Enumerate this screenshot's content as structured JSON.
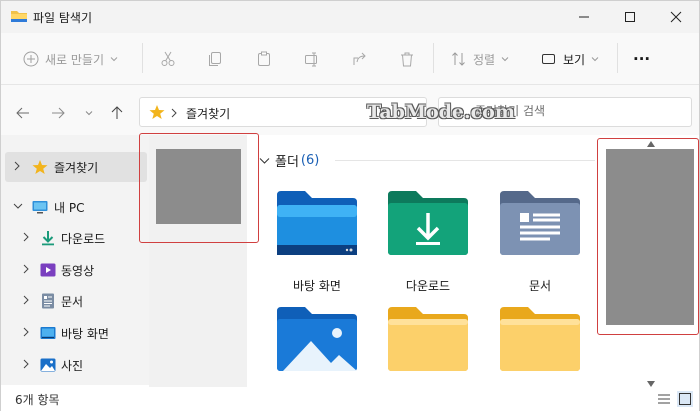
{
  "window": {
    "title": "파일 탐색기"
  },
  "title_controls": {
    "minimize": "—",
    "maximize": "☐",
    "close": "✕"
  },
  "toolbar": {
    "new_label": "새로 만들기",
    "sort_label": "정렬",
    "view_label": "보기",
    "more_label": "···"
  },
  "address": {
    "crumb": "즐겨찾기"
  },
  "search": {
    "placeholder": "즐겨찾기 검색"
  },
  "watermark": "TabMode.com",
  "sidebar": {
    "items": [
      {
        "label": "즐겨찾기",
        "icon": "star-icon"
      },
      {
        "label": "내 PC",
        "icon": "pc-icon"
      },
      {
        "label": "다운로드",
        "icon": "download-icon"
      },
      {
        "label": "동영상",
        "icon": "video-icon"
      },
      {
        "label": "문서",
        "icon": "document-icon"
      },
      {
        "label": "바탕 화면",
        "icon": "desktop-icon"
      },
      {
        "label": "사진",
        "icon": "pictures-icon"
      }
    ]
  },
  "main": {
    "section_title": "폴더",
    "section_count": "(6)",
    "folders": [
      {
        "label": "바탕 화면",
        "icon": "desktop-folder-icon"
      },
      {
        "label": "다운로드",
        "icon": "downloads-folder-icon"
      },
      {
        "label": "문서",
        "icon": "documents-folder-icon"
      },
      {
        "label": "",
        "icon": "pictures-folder-icon"
      },
      {
        "label": "",
        "icon": "yellow-folder-icon"
      },
      {
        "label": "",
        "icon": "yellow-folder-icon"
      }
    ]
  },
  "status": {
    "item_count": "6개 항목"
  },
  "colors": {
    "accent": "#1a5fb4",
    "annotation_red": "#d04040",
    "redaction_gray": "#8c8c8c"
  }
}
